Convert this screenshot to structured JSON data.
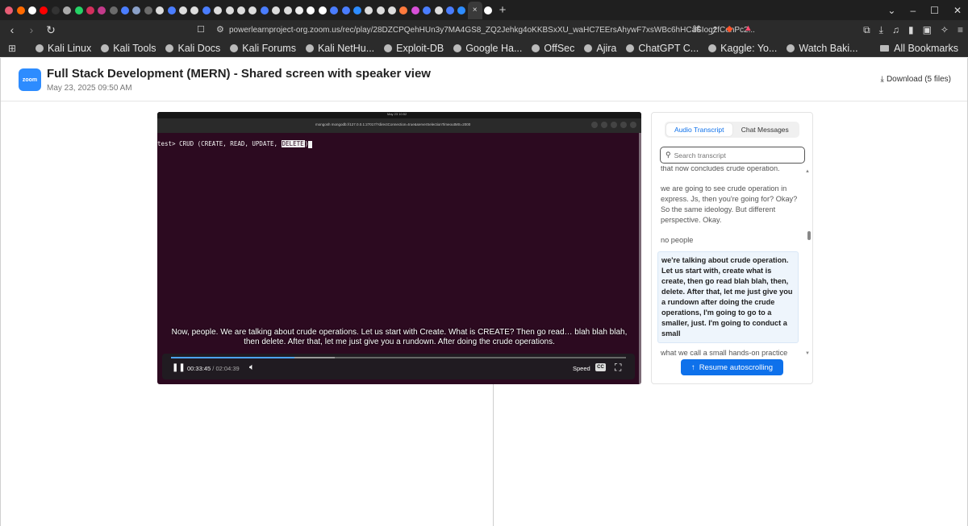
{
  "browser": {
    "url": "powerlearnproject-org.zoom.us/rec/play/28DZCPQehHUn3y7MA4GS8_ZQ2Jehkg4oKKBSxXU_waHC7EErsAhywF7xsWBc6hHCaSIoq2fCenPc2...",
    "tab_close": "×",
    "new_tab": "+",
    "bookmarks": [
      {
        "label": "Kali Linux"
      },
      {
        "label": "Kali Tools"
      },
      {
        "label": "Kali Docs"
      },
      {
        "label": "Kali Forums"
      },
      {
        "label": "Kali NetHu..."
      },
      {
        "label": "Exploit-DB"
      },
      {
        "label": "Google Ha..."
      },
      {
        "label": "OffSec"
      },
      {
        "label": "Ajira"
      },
      {
        "label": "ChatGPT C..."
      },
      {
        "label": "Kaggle: Yo..."
      },
      {
        "label": "Watch Baki..."
      }
    ],
    "all_bookmarks": "All Bookmarks",
    "favicon_colors": [
      "#e85d75",
      "#ff6a00",
      "#ffffff",
      "#ff0000",
      "#333333",
      "#aaaaaa",
      "#25d366",
      "#d22f5c",
      "#c23a8a",
      "#6b6b6b",
      "#4a7dff",
      "#8aa0c8",
      "#6b6b6b",
      "#dddddd",
      "#4a7dff",
      "#dddddd",
      "#dddddd",
      "#4a7dff",
      "#dddddd",
      "#dddddd",
      "#dddddd",
      "#dddddd",
      "#4a7dff",
      "#dddddd",
      "#dddddd",
      "#eeeeee",
      "#ffffff",
      "#ffffff",
      "#4a7dff",
      "#4a7dff",
      "#2d8cff",
      "#dddddd",
      "#dddddd",
      "#dddddd",
      "#ff7a3d",
      "#d84fd8",
      "#4a7dff",
      "#dddddd",
      "#4a7dff",
      "#2d8cff",
      "#ffffff"
    ]
  },
  "header": {
    "logo_text": "zoom",
    "title": "Full Stack Development (MERN) - Shared screen with speaker view",
    "date": "May 23, 2025 09:50 AM",
    "download": "Download (5 files)"
  },
  "player": {
    "desktop_clock": "May 23  10:52",
    "terminal_title": "mongosh mongodb://127.0.0.1:27017/?directConnection=true&serverSelectionTimeoutMS=2000",
    "terminal_prompt": "test> CRUD (CREATE, READ, UPDATE, ",
    "terminal_selected": "DELETE",
    "terminal_after": ")",
    "caption": "Now, people. We are talking about crude operations. Let us start with Create. What is CREATE? Then go read… blah blah blah, then delete. After that, let me just give you a rundown. After doing the crude operations.",
    "current_time": "00:33:45",
    "separator": "/",
    "duration": "02:04:39",
    "progress_fraction": 0.271,
    "buffer_fraction": 0.36,
    "speed_label": "Speed",
    "cc_label": "CC"
  },
  "transcript": {
    "tabs": [
      {
        "label": "Audio Transcript",
        "active": true
      },
      {
        "label": "Chat Messages",
        "active": false
      }
    ],
    "search_placeholder": "Search transcript",
    "lines": [
      {
        "text": "that now concludes crude operation."
      },
      {
        "text": "we are going to see crude operation in express. Js, then you're going for? Okay? So the same ideology. But different perspective. Okay."
      },
      {
        "text": "no people"
      },
      {
        "text": "we're talking about crude operation. Let us start with, create what is create, then go read blah blah, then, delete. After that, let me just give you a rundown after doing the crude operations, I'm going to go to a smaller, just. I'm going to conduct a small"
      },
      {
        "text": "what we call a small hands-on practice"
      }
    ],
    "resume_button": "Resume autoscrolling"
  },
  "colors": {
    "zoom_blue": "#0e71eb",
    "logo_blue": "#2d8cff",
    "terminal_bg": "#2c0a20"
  }
}
